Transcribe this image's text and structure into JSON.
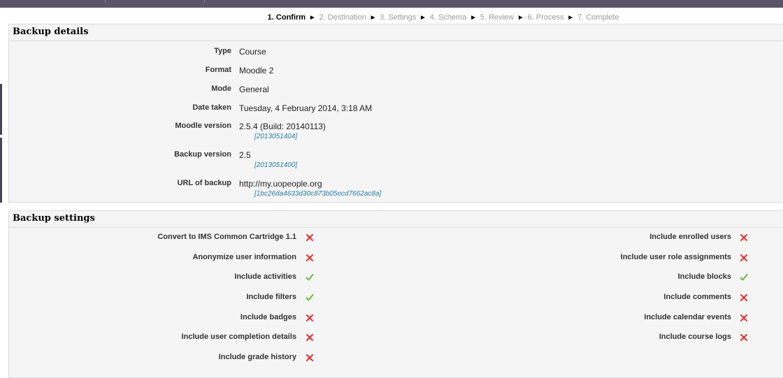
{
  "progress": {
    "steps": [
      "1. Confirm",
      "2. Destination",
      "3. Settings",
      "4. Schema",
      "5. Review",
      "6. Process",
      "7. Complete"
    ],
    "current": 0,
    "arrow": "►"
  },
  "backup_details": {
    "legend": "Backup details",
    "rows": [
      {
        "label": "Type",
        "value": "Course"
      },
      {
        "label": "Format",
        "value": "Moodle 2"
      },
      {
        "label": "Mode",
        "value": "General"
      },
      {
        "label": "Date taken",
        "value": "Tuesday, 4 February 2014, 3:18 AM"
      },
      {
        "label": "Moodle version",
        "value": "2.5.4 (Build: 20140113)",
        "sub": "[2013051404]"
      },
      {
        "label": "Backup version",
        "value": "2.5",
        "sub": "[2013051400]"
      },
      {
        "label": "URL of backup",
        "value": "http://my.uopeople.org",
        "sub": "[1bc26da4633d30c873b05ecd7662ac8a]"
      }
    ]
  },
  "backup_settings": {
    "legend": "Backup settings",
    "left": [
      {
        "label": "Convert to IMS Common Cartridge 1.1",
        "icon": "cross-icon"
      },
      {
        "label": "Anonymize user information",
        "icon": "cross-icon"
      },
      {
        "label": "Include activities",
        "icon": "check-icon"
      },
      {
        "label": "Include filters",
        "icon": "check-icon"
      },
      {
        "label": "Include badges",
        "icon": "cross-icon"
      },
      {
        "label": "Include user completion details",
        "icon": "cross-icon"
      },
      {
        "label": "Include grade history",
        "icon": "cross-icon"
      }
    ],
    "right": [
      {
        "label": "Include enrolled users",
        "icon": "cross-icon"
      },
      {
        "label": "Include user role assignments",
        "icon": "cross-icon"
      },
      {
        "label": "Include blocks",
        "icon": "check-icon"
      },
      {
        "label": "Include comments",
        "icon": "cross-icon"
      },
      {
        "label": "Include calendar events",
        "icon": "cross-icon"
      },
      {
        "label": "Include course logs",
        "icon": "cross-icon"
      }
    ]
  },
  "colors": {
    "cross": "#e03030",
    "check": "#6ab93c",
    "link": "#2a7fa8"
  }
}
